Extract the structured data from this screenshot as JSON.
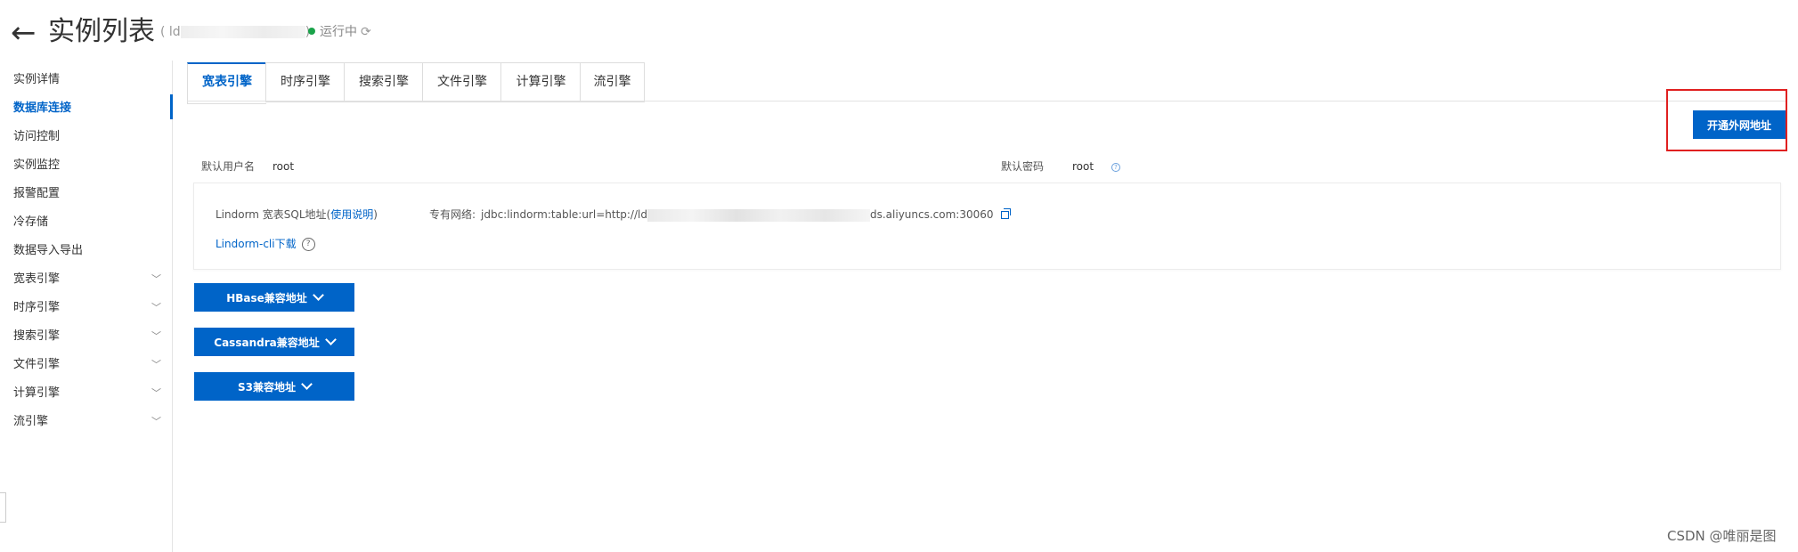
{
  "header": {
    "back_icon": "arrow-left-icon",
    "title": "实例列表",
    "instance_id_prefix": "( ld",
    "instance_id_suffix": ")",
    "status": "运行中",
    "status_color": "#1aa34a",
    "refresh_icon": "refresh-icon"
  },
  "sidebar": {
    "items": [
      {
        "label": "实例详情"
      },
      {
        "label": "数据库连接",
        "active": true
      },
      {
        "label": "访问控制"
      },
      {
        "label": "实例监控"
      },
      {
        "label": "报警配置"
      },
      {
        "label": "冷存储"
      },
      {
        "label": "数据导入导出"
      },
      {
        "label": "宽表引擎",
        "expandable": true
      },
      {
        "label": "时序引擎",
        "expandable": true
      },
      {
        "label": "搜索引擎",
        "expandable": true
      },
      {
        "label": "文件引擎",
        "expandable": true
      },
      {
        "label": "计算引擎",
        "expandable": true
      },
      {
        "label": "流引擎",
        "expandable": true
      }
    ]
  },
  "tabs": [
    {
      "label": "宽表引擎",
      "active": true
    },
    {
      "label": "时序引擎"
    },
    {
      "label": "搜索引擎"
    },
    {
      "label": "文件引擎"
    },
    {
      "label": "计算引擎"
    },
    {
      "label": "流引擎"
    }
  ],
  "actions": {
    "open_public_label": "开通外网地址"
  },
  "credentials": {
    "user_label": "默认用户名",
    "user_value": "root",
    "password_label": "默认密码",
    "password_value": "root"
  },
  "sql_panel": {
    "label_prefix": "Lindorm 宽表SQL地址(",
    "usage_link": "使用说明",
    "label_suffix": ")",
    "vpc_label": "专有网络:",
    "jdbc_prefix": "jdbc:lindorm:table:url=http://ld",
    "jdbc_suffix": "ds.aliyuncs.com:30060",
    "cli_link": "Lindorm-cli下载"
  },
  "compat_buttons": [
    {
      "label": "HBase兼容地址"
    },
    {
      "label": "Cassandra兼容地址"
    },
    {
      "label": "S3兼容地址"
    }
  ],
  "watermark": "CSDN @唯丽是图",
  "colors": {
    "primary": "#0064c8",
    "highlight_box": "#e02020"
  }
}
